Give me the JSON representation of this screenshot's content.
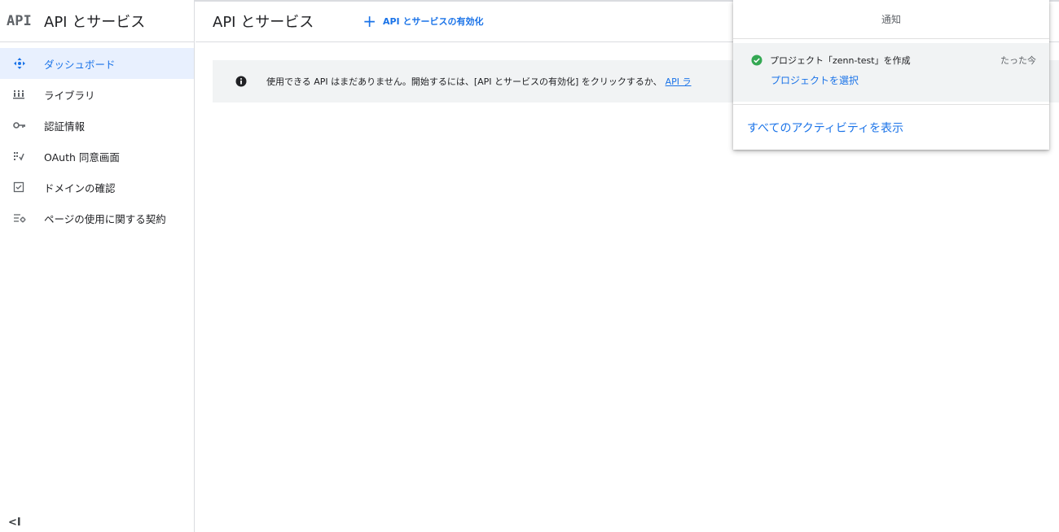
{
  "sidebar": {
    "logo": "API",
    "title": "API とサービス",
    "items": [
      {
        "label": "ダッシュボード",
        "icon": "dashboard-icon"
      },
      {
        "label": "ライブラリ",
        "icon": "library-icon"
      },
      {
        "label": "認証情報",
        "icon": "key-icon"
      },
      {
        "label": "OAuth 同意画面",
        "icon": "consent-icon"
      },
      {
        "label": "ドメインの確認",
        "icon": "domain-check-icon"
      },
      {
        "label": "ページの使用に関する契約",
        "icon": "page-agreement-icon"
      }
    ],
    "collapse_label": "<I"
  },
  "main": {
    "title": "API とサービス",
    "enable_button": {
      "icon": "+",
      "label": "API とサービスの有効化"
    },
    "info_banner": {
      "text": "使用できる API はまだありません。開始するには、[API とサービスの有効化] をクリックするか、",
      "link": "API ラ"
    }
  },
  "notifications": {
    "title": "通知",
    "items": [
      {
        "message": "プロジェクト「zenn-test」を作成",
        "time": "たった今",
        "action": "プロジェクトを選択",
        "status_color": "#34a853"
      }
    ],
    "view_all": "すべてのアクティビティを表示"
  },
  "colors": {
    "accent": "#1a73e8",
    "active_bg": "#e8f0fe",
    "banner_bg": "#f1f3f4",
    "success": "#34a853"
  }
}
